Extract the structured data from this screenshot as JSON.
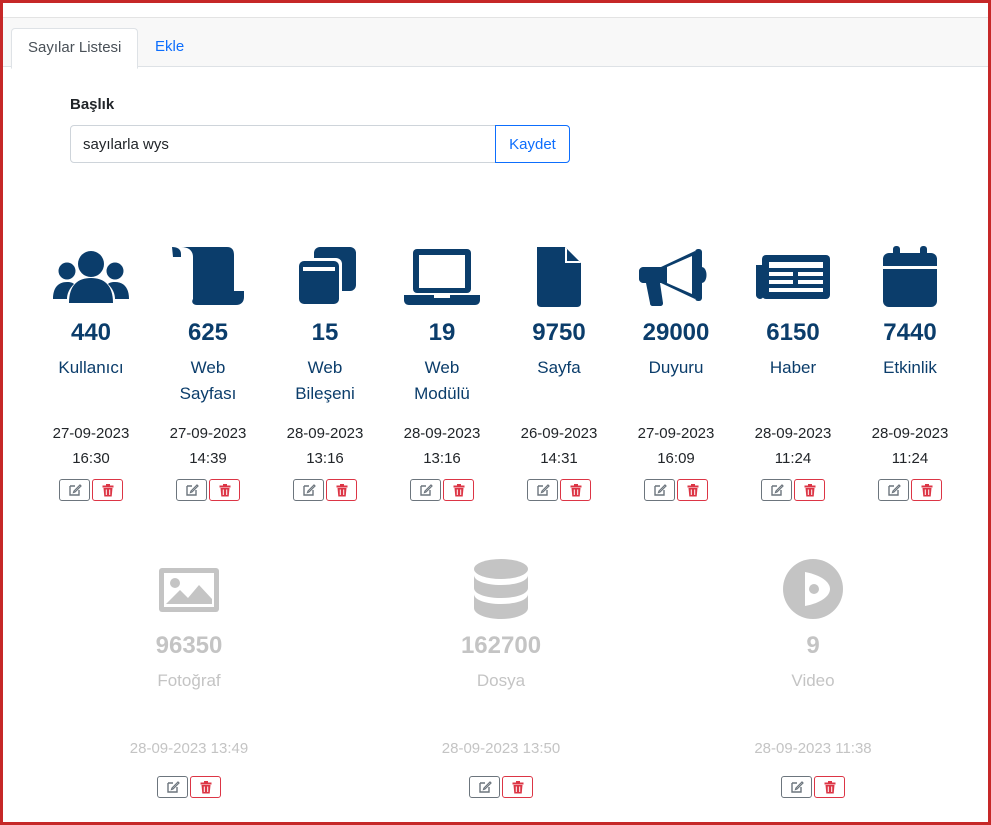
{
  "tabs": [
    {
      "label": "Sayılar Listesi",
      "active": true
    },
    {
      "label": "Ekle",
      "active": false
    }
  ],
  "form": {
    "label": "Başlık",
    "value": "sayılarla wys",
    "save_label": "Kaydet"
  },
  "colors": {
    "primary": "#0b3d6b",
    "muted": "#c4c4c4",
    "danger": "#dc3545",
    "frame": "#c62828"
  },
  "stats_row1": [
    {
      "icon": "users-icon",
      "number": "440",
      "label1": "Kullanıcı",
      "label2": "",
      "date": "27-09-2023",
      "time": "16:30"
    },
    {
      "icon": "scroll-icon",
      "number": "625",
      "label1": "Web",
      "label2": "Sayfası",
      "date": "27-09-2023",
      "time": "14:39"
    },
    {
      "icon": "clone-icon",
      "number": "15",
      "label1": "Web",
      "label2": "Bileşeni",
      "date": "28-09-2023",
      "time": "13:16"
    },
    {
      "icon": "laptop-icon",
      "number": "19",
      "label1": "Web",
      "label2": "Modülü",
      "date": "28-09-2023",
      "time": "13:16"
    },
    {
      "icon": "file-icon",
      "number": "9750",
      "label1": "Sayfa",
      "label2": "",
      "date": "26-09-2023",
      "time": "14:31"
    },
    {
      "icon": "bullhorn-icon",
      "number": "29000",
      "label1": "Duyuru",
      "label2": "",
      "date": "27-09-2023",
      "time": "16:09"
    },
    {
      "icon": "newspaper-icon",
      "number": "6150",
      "label1": "Haber",
      "label2": "",
      "date": "28-09-2023",
      "time": "11:24"
    },
    {
      "icon": "calendar-icon",
      "number": "7440",
      "label1": "Etkinlik",
      "label2": "",
      "date": "28-09-2023",
      "time": "11:24"
    }
  ],
  "stats_row2": [
    {
      "icon": "image-icon",
      "number": "96350",
      "label": "Fotoğraf",
      "datetime": "28-09-2023 13:49"
    },
    {
      "icon": "database-icon",
      "number": "162700",
      "label": "Dosya",
      "datetime": "28-09-2023 13:50"
    },
    {
      "icon": "video-icon",
      "number": "9",
      "label": "Video",
      "datetime": "28-09-2023 11:38"
    }
  ]
}
